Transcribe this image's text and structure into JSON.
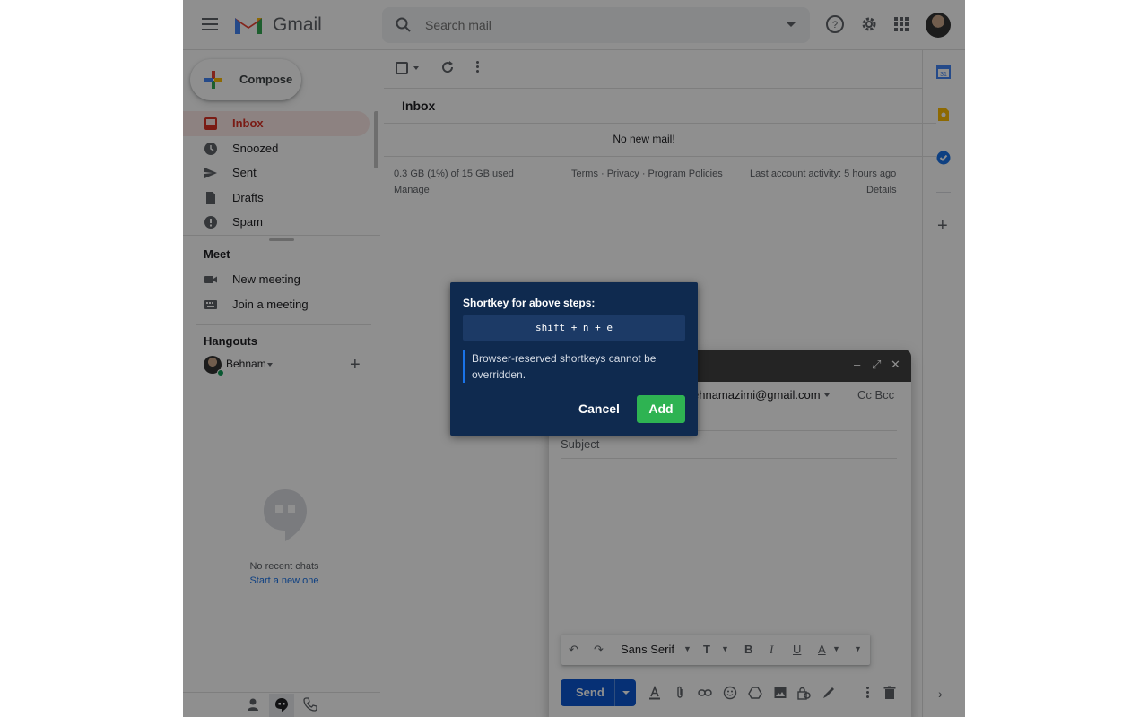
{
  "app": {
    "brand": "Gmail"
  },
  "search": {
    "placeholder": "Search mail"
  },
  "compose_button": {
    "label": "Compose"
  },
  "sidebar": {
    "items": [
      {
        "label": "Inbox",
        "icon": "inbox-icon",
        "active": true
      },
      {
        "label": "Snoozed",
        "icon": "clock-icon"
      },
      {
        "label": "Sent",
        "icon": "send-icon"
      },
      {
        "label": "Drafts",
        "icon": "draft-icon"
      },
      {
        "label": "Spam",
        "icon": "spam-icon"
      }
    ],
    "meet": {
      "title": "Meet",
      "items": [
        {
          "label": "New meeting"
        },
        {
          "label": "Join a meeting"
        }
      ]
    },
    "hangouts": {
      "title": "Hangouts",
      "user": "Behnam",
      "no_chats": "No recent chats",
      "start_chat": "Start a new one"
    }
  },
  "main": {
    "tab": "Inbox",
    "empty_message": "No new mail!",
    "storage": "0.3 GB (1%) of 15 GB used",
    "manage": "Manage",
    "links": "Terms · Privacy · Program Policies",
    "activity": "Last account activity: 5 hours ago",
    "details": "Details"
  },
  "compose_window": {
    "to": "ehnamazimi@gmail.com",
    "ccbcc": "Cc Bcc",
    "subject_placeholder": "Subject",
    "font": "Sans Serif",
    "send_label": "Send"
  },
  "dialog": {
    "title": "Shortkey for above steps:",
    "shortcut": "shift + n + e",
    "note": "Browser-reserved shortkeys cannot be overridden.",
    "cancel": "Cancel",
    "add": "Add"
  },
  "colors": {
    "accent": "#1a73e8",
    "dialog_bg": "#0f2a4f",
    "add_button": "#2eb352",
    "inbox_active": "#d93025"
  }
}
